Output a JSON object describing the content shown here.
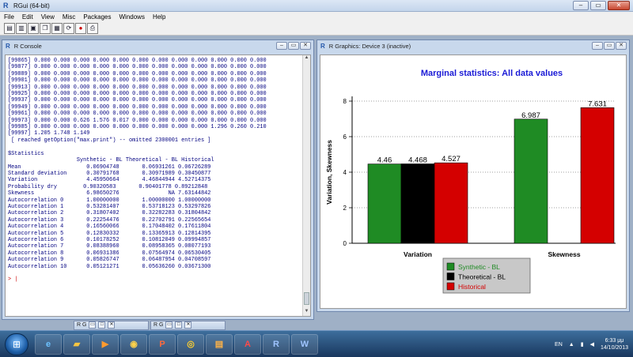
{
  "app": {
    "title": "RGui (64-bit)",
    "menu": [
      "File",
      "Edit",
      "View",
      "Misc",
      "Packages",
      "Windows",
      "Help"
    ],
    "toolbar_icons": [
      "open-script-icon",
      "load-workspace-icon",
      "save-workspace-icon",
      "copy-icon",
      "paste-icon",
      "copy-paste-icon",
      "stop-icon",
      "print-icon"
    ]
  },
  "console": {
    "title": "R Console",
    "lines": [
      "[99865] 0.000 0.000 0.000 0.000 0.000 0.000 0.000 0.000 0.000 0.000 0.000 0.000",
      "[99877] 0.000 0.000 0.000 0.000 0.000 0.000 0.000 0.000 0.000 0.000 0.000 0.000",
      "[99889] 0.000 0.000 0.000 0.000 0.000 0.000 0.000 0.000 0.000 0.000 0.000 0.000",
      "[99901] 0.000 0.000 0.000 0.000 0.000 0.000 0.000 0.000 0.000 0.000 0.000 0.000",
      "[99913] 0.000 0.000 0.000 0.000 0.000 0.000 0.000 0.000 0.000 0.000 0.000 0.000",
      "[99925] 0.000 0.000 0.000 0.000 0.000 0.000 0.000 0.000 0.000 0.000 0.000 0.000",
      "[99937] 0.000 0.000 0.000 0.000 0.000 0.000 0.000 0.000 0.000 0.000 0.000 0.000",
      "[99949] 0.000 0.000 0.000 0.000 0.000 0.000 0.000 0.000 0.000 0.000 0.000 0.000",
      "[99961] 0.000 0.000 0.000 0.000 0.000 0.000 0.000 0.000 0.000 0.000 0.000 0.000",
      "[99973] 0.000 0.000 0.626 1.576 0.017 0.000 0.000 0.000 0.000 0.000 0.000 0.000",
      "[99985] 0.000 0.000 0.000 0.000 0.000 0.000 0.000 0.000 0.000 1.296 0.260 0.210",
      "[99997] 1.205 1.748 1.149",
      " [ reached getOption(\"max.print\") -- omitted 2300001 entries ]",
      "",
      "$Statistics",
      "                     Synthetic - BL Theoretical - BL Historical",
      "Mean                    0.06904748       0.06931261 0.06726289",
      "Standard deviation      0.30791768       0.30971989 0.30450877",
      "Variation               4.45950664       4.46844944 4.52714375",
      "Probability dry        0.90320583       0.90401778 0.89212848",
      "Skewness                6.98650276               NA 7.63144842",
      "Autocorrelation 0       1.00000000       1.00000000 1.00000000",
      "Autocorrelation 1       0.53281407       0.53718123 0.53297826",
      "Autocorrelation 2       0.31807402       0.32282283 0.31804842",
      "Autocorrelation 3       0.22254476       0.22702791 0.22565654",
      "Autocorrelation 4       0.16560066       0.17048402 0.17611804",
      "Autocorrelation 5       0.12830332       0.13365913 0.12814395",
      "Autocorrelation 6       0.10178252       0.10812049 0.09994857",
      "Autocorrelation 7       0.08388960       0.08958365 0.08077193",
      "Autocorrelation 8       0.06931386       0.07564974 0.06530405",
      "Autocorrelation 9       0.05826747       0.06487954 0.04708597",
      "Autocorrelation 10      0.05121271       0.05636260 0.03671300"
    ],
    "prompt": ">"
  },
  "graphics": {
    "title": "R Graphics: Device 3 (inactive)"
  },
  "chart_data": {
    "type": "bar",
    "title": "Marginal statistics: All data values",
    "xlabel": "",
    "ylabel": "Variation, Skewness",
    "categories": [
      "Variation",
      "Skewness"
    ],
    "ylim": [
      0,
      8
    ],
    "yticks": [
      0,
      2,
      4,
      6,
      8
    ],
    "grid": true,
    "series": [
      {
        "name": "Synthetic - BL",
        "color": "#1f8b24",
        "values": [
          4.46,
          6.987
        ],
        "labels": [
          "4.46",
          "6.987"
        ]
      },
      {
        "name": "Theoretical - BL",
        "color": "#000000",
        "values": [
          4.468,
          null
        ],
        "labels": [
          "4.468",
          ""
        ]
      },
      {
        "name": "Historical",
        "color": "#d40000",
        "values": [
          4.527,
          7.631
        ],
        "labels": [
          "4.527",
          "7.631"
        ]
      }
    ],
    "legend_position": "bottom"
  },
  "minimized": [
    {
      "label": "R G"
    },
    {
      "label": "R G"
    }
  ],
  "taskbar": {
    "language": "EN",
    "time": "6:33 μμ",
    "date": "14/10/2013",
    "icons": [
      "windows-start-icon",
      "internet-explorer-icon",
      "folder-icon",
      "media-player-icon",
      "outlook-icon",
      "powerpoint-icon",
      "chrome-icon",
      "pdf-icon",
      "acrobat-icon",
      "r-icon",
      "word-icon"
    ]
  }
}
